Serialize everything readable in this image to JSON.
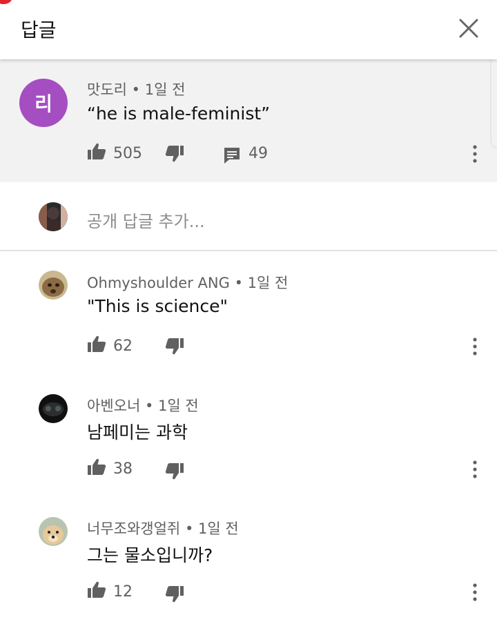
{
  "header": {
    "title": "답글",
    "close_icon": "close-icon"
  },
  "parent_comment": {
    "avatar_letter": "리",
    "avatar_color": "#a44ec2",
    "author": "맛도리",
    "time": "1일 전",
    "text": "“he is male-feminist”",
    "likes": "505",
    "replies": "49"
  },
  "add_reply": {
    "placeholder": "공개 답글 추가..."
  },
  "replies": [
    {
      "author": "Ohmyshoulder ANG",
      "time": "1일 전",
      "text": "\"This is science\"",
      "likes": "62"
    },
    {
      "author": "아벤오너",
      "time": "1일 전",
      "text": "남페미는 과학",
      "likes": "38"
    },
    {
      "author": "너무조와갱얼쥐",
      "time": "1일 전",
      "text": "그는 물소입니까?",
      "likes": "12"
    }
  ],
  "separator": "•"
}
